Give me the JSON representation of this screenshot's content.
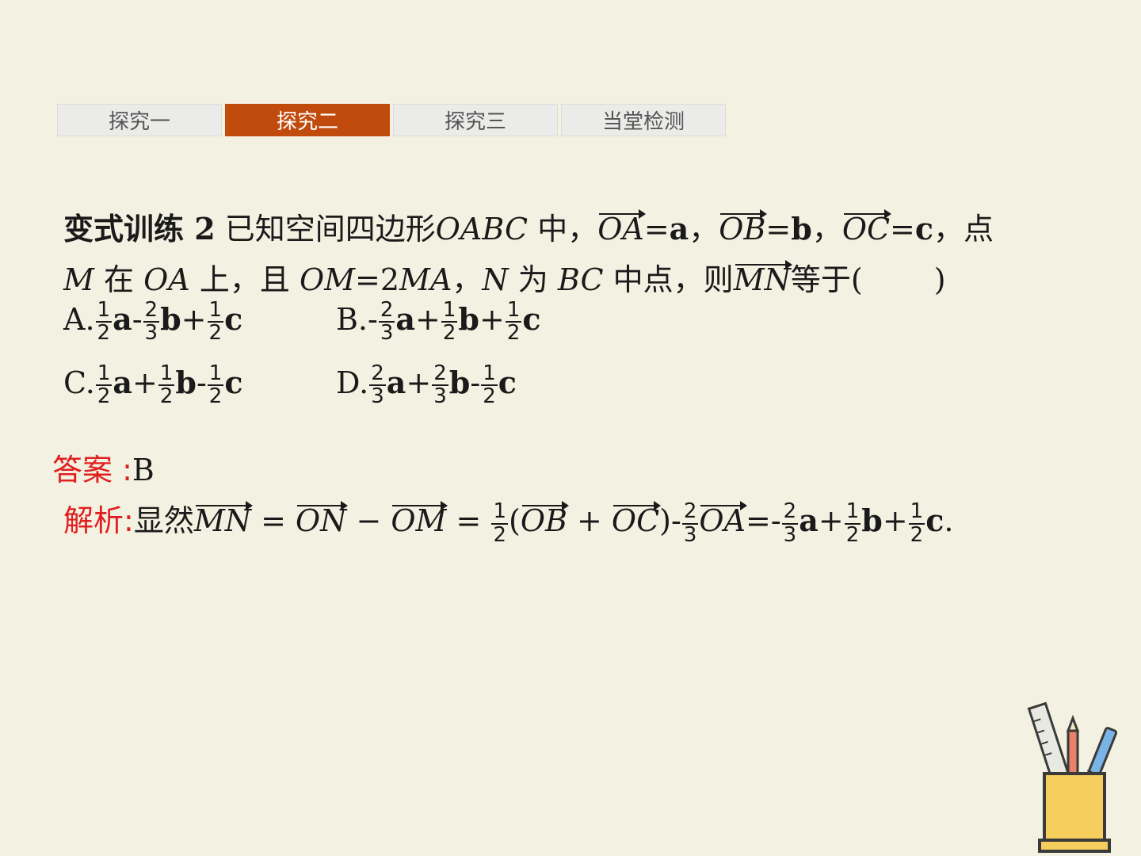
{
  "tabs": [
    {
      "label": "探究一",
      "active": false
    },
    {
      "label": "探究二",
      "active": true
    },
    {
      "label": "探究三",
      "active": false
    },
    {
      "label": "当堂检测",
      "active": false
    }
  ],
  "problem": {
    "heading": "变式训练 2",
    "text_1": "已知空间四边形",
    "quad": "OABC",
    "text_2": "中，",
    "vec_OA": "OA",
    "val_a": "a",
    "vec_OB": "OB",
    "val_b": "b",
    "vec_OC": "OC",
    "val_c": "c",
    "text_3": "点",
    "M": "M",
    "text_4": "在",
    "OA": "OA",
    "text_5": "上，且",
    "OM_eq": "OM",
    "eq_sign": "=2",
    "MA": "MA",
    "comma": "，",
    "N": "N",
    "text_6": "为",
    "BC": "BC",
    "text_7": "中点，则",
    "vec_MN": "MN",
    "text_8": "等于(",
    "close_paren": ")"
  },
  "options": {
    "A": {
      "label": "A.",
      "terms": [
        "1/2 a",
        "- 2/3 b",
        "+ 1/2 c"
      ]
    },
    "B": {
      "label": "B.",
      "terms": [
        "- 2/3 a",
        "+ 1/2 b",
        "+ 1/2 c"
      ]
    },
    "C": {
      "label": "C.",
      "terms": [
        "1/2 a",
        "+ 1/2 b",
        "- 1/2 c"
      ]
    },
    "D": {
      "label": "D.",
      "terms": [
        "2/3 a",
        "+ 2/3 b",
        "- 1/2 c"
      ]
    }
  },
  "answer": {
    "label": "答案 :",
    "value": "B"
  },
  "analysis": {
    "label": "解析:",
    "lead": "显然"
  },
  "colors": {
    "background": "#f3f1e1",
    "active_tab": "#c14b0c",
    "label_red": "#e02020"
  }
}
